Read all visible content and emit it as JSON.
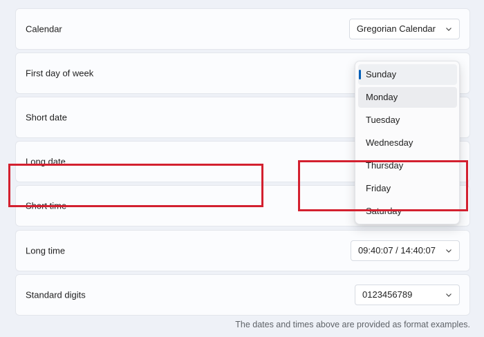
{
  "rows": [
    {
      "label": "Calendar",
      "value": "Gregorian Calendar"
    },
    {
      "label": "First day of week"
    },
    {
      "label": "Short date"
    },
    {
      "label": "Long date"
    },
    {
      "label": "Short time"
    },
    {
      "label": "Long time",
      "value": "09:40:07 / 14:40:07"
    },
    {
      "label": "Standard digits",
      "value": "0123456789"
    }
  ],
  "dropdown": {
    "selected": "Sunday",
    "options": [
      "Sunday",
      "Monday",
      "Tuesday",
      "Wednesday",
      "Thursday",
      "Friday",
      "Saturday"
    ]
  },
  "footnote": "The dates and times above are provided as format examples.",
  "colors": {
    "accent": "#005fb8",
    "highlight": "#d3202f"
  },
  "icons": {
    "select_chevron": "chevron-down-icon"
  }
}
